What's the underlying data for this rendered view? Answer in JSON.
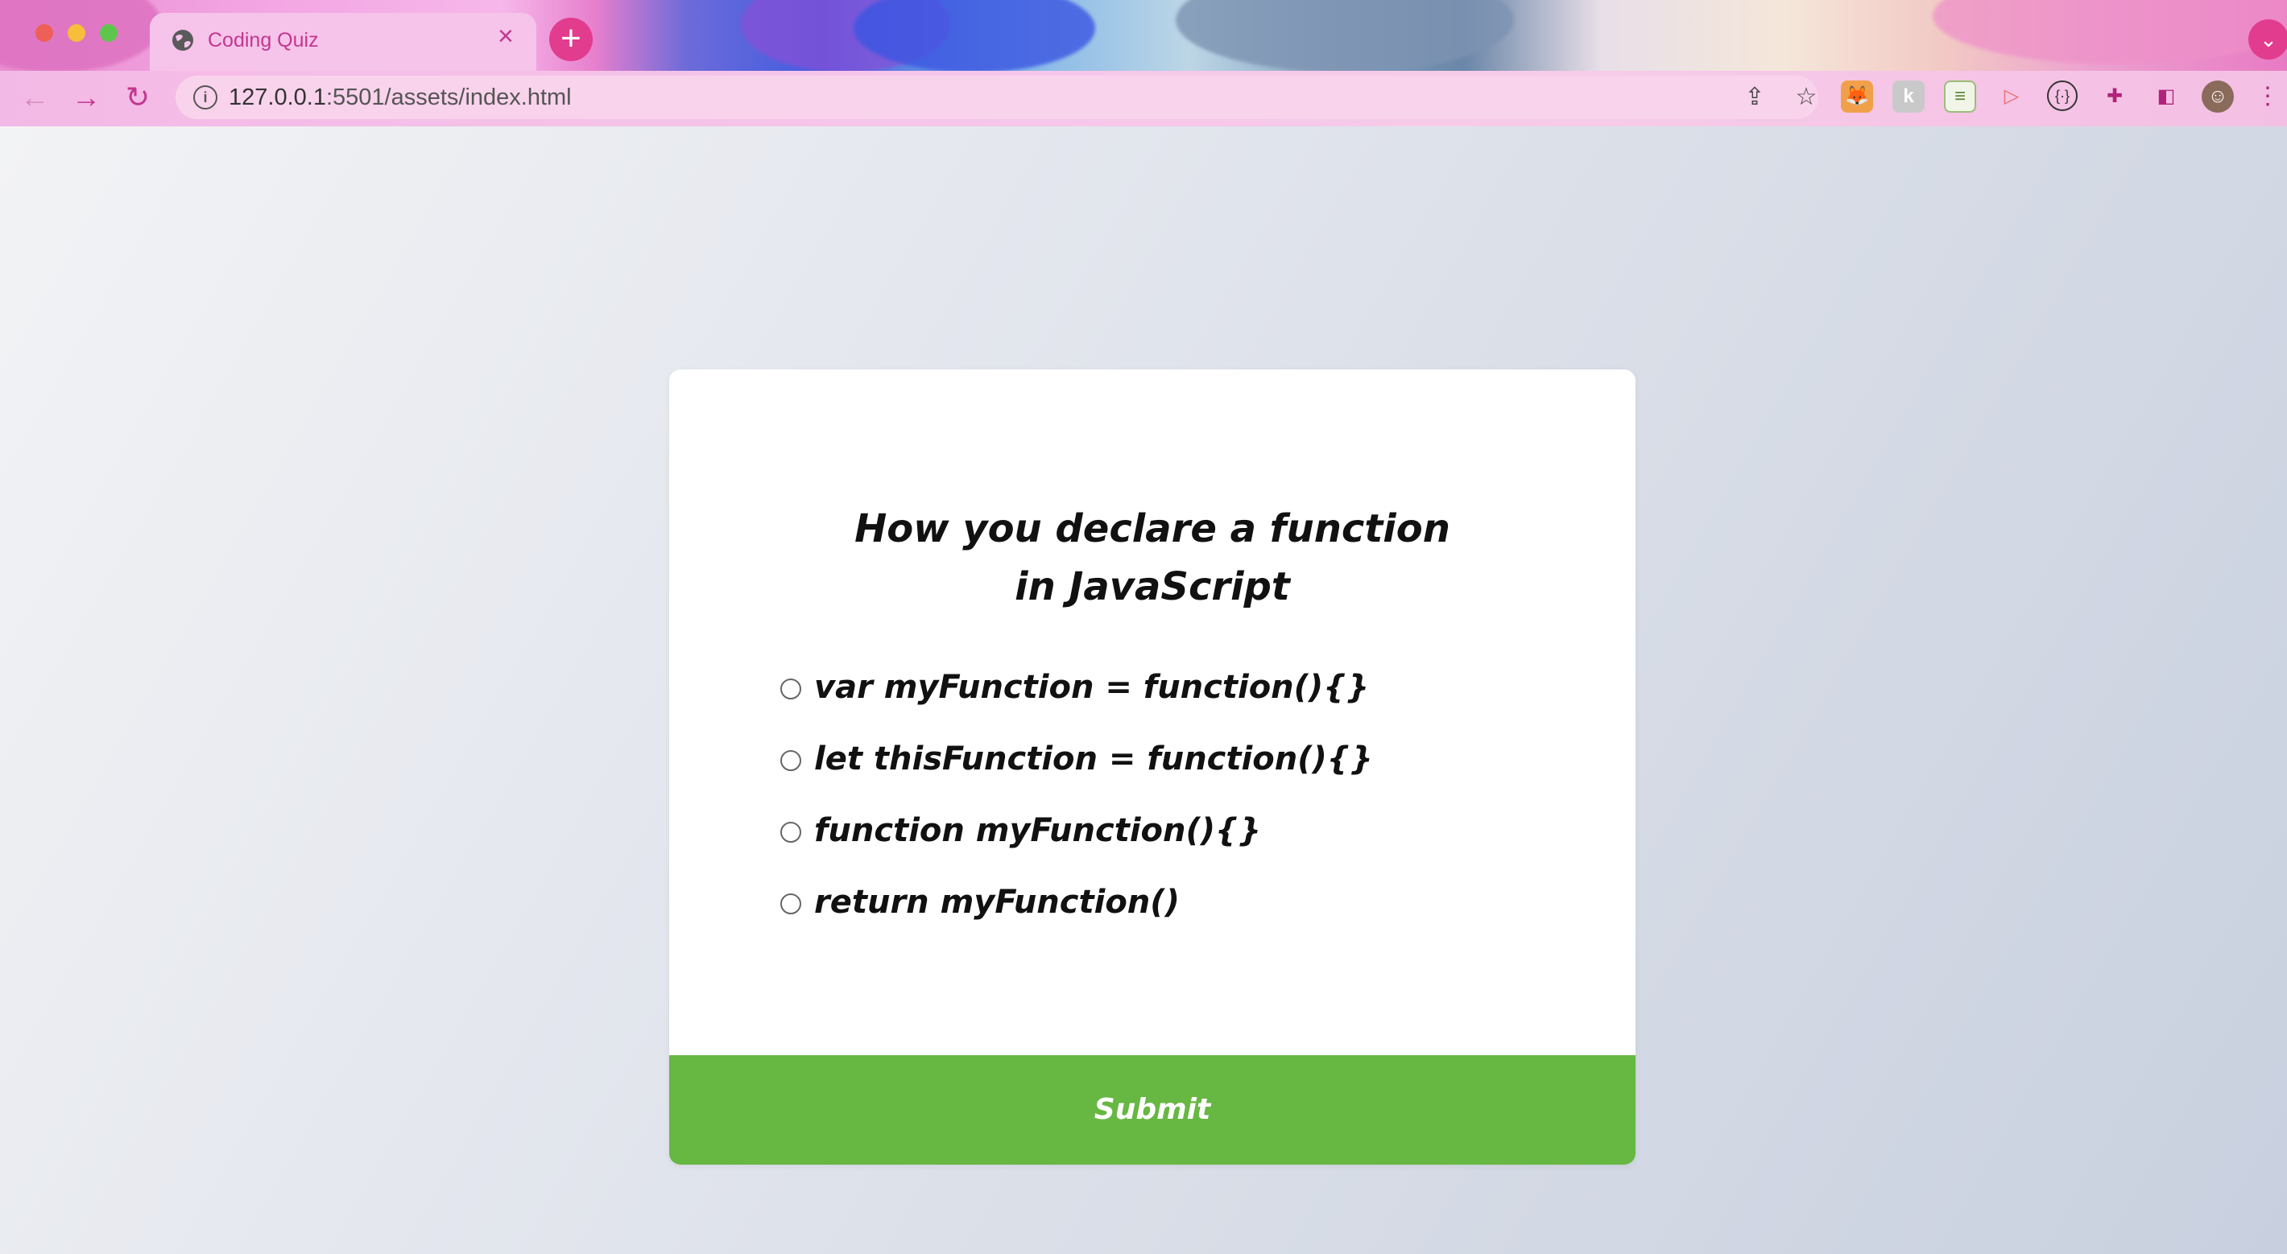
{
  "browser": {
    "tab_title": "Coding Quiz",
    "tab_close": "×",
    "new_tab": "+",
    "url_host": "127.0.0.1",
    "url_rest": ":5501/assets/index.html",
    "nav": {
      "back": "←",
      "forward": "→",
      "reload": "↻"
    },
    "extensions": [
      "fox-extension-icon",
      "k-extension-icon",
      "sheet-extension-icon",
      "record-extension-icon",
      "braces-extension-icon",
      "puzzle-extensions-icon",
      "sidepanel-icon",
      "profile-avatar"
    ]
  },
  "quiz": {
    "question": "How you declare a function in JavaScript",
    "answers": [
      "var myFunction = function(){}",
      "let thisFunction = function(){}",
      "function myFunction(){}",
      "return myFunction()"
    ],
    "submit_label": "Submit"
  },
  "colors": {
    "submit_bg": "#67b743",
    "accent": "#e23c8f"
  }
}
